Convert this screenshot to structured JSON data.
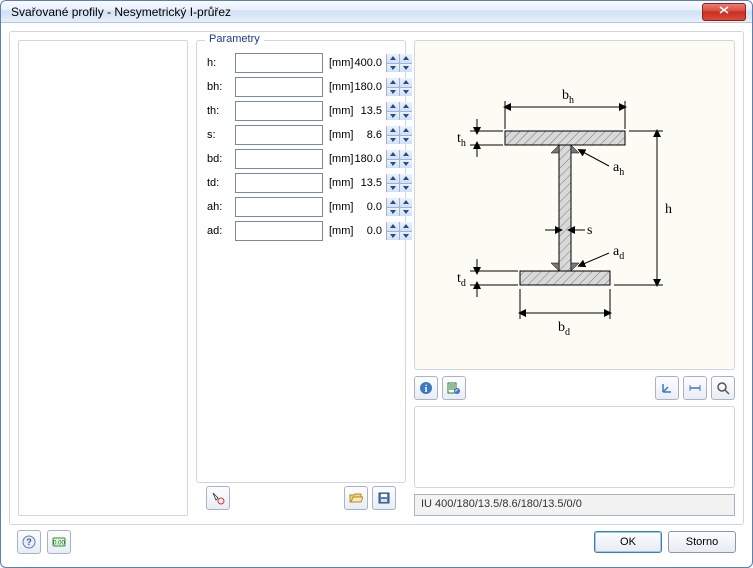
{
  "window": {
    "title": "Svařované profily - Nesymetrický I-průřez"
  },
  "paramsGroup": {
    "title": "Parametry"
  },
  "params": [
    {
      "label": "h:",
      "value": "400.0",
      "unit": "[mm]"
    },
    {
      "label": "bh:",
      "value": "180.0",
      "unit": "[mm]"
    },
    {
      "label": "th:",
      "value": "13.5",
      "unit": "[mm]"
    },
    {
      "label": "s:",
      "value": "8.6",
      "unit": "[mm]"
    },
    {
      "label": "bd:",
      "value": "180.0",
      "unit": "[mm]"
    },
    {
      "label": "td:",
      "value": "13.5",
      "unit": "[mm]"
    },
    {
      "label": "ah:",
      "value": "0.0",
      "unit": "[mm]"
    },
    {
      "label": "ad:",
      "value": "0.0",
      "unit": "[mm]"
    }
  ],
  "diagram": {
    "labels": {
      "bh": "b",
      "bh_sub": "h",
      "th": "t",
      "th_sub": "h",
      "ah": "a",
      "ah_sub": "h",
      "s": "s",
      "h": "h",
      "ad": "a",
      "ad_sub": "d",
      "td": "t",
      "td_sub": "d",
      "bd": "b",
      "bd_sub": "d"
    }
  },
  "profileCode": "IU 400/180/13.5/8.6/180/13.5/0/0",
  "buttons": {
    "ok": "OK",
    "cancel": "Storno"
  }
}
